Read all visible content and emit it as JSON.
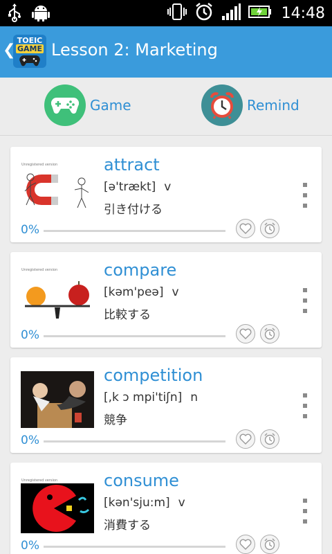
{
  "status_bar": {
    "time": "14:48",
    "icons": [
      "usb-icon",
      "android-debug-icon",
      "vibrate-icon",
      "alarm-clock-icon",
      "signal-icon",
      "battery-charging-icon"
    ]
  },
  "action_bar": {
    "back_icon": "chevron-left-icon",
    "logo_line1": "TOEIC",
    "logo_line2": "GAME",
    "title": "Lesson 2: Marketing"
  },
  "toolbar": {
    "game_label": "Game",
    "remind_label": "Remind",
    "game_color": "#3fc07a",
    "remind_color": "#3e8f96"
  },
  "cards": [
    {
      "word": "attract",
      "pronunciation": "[ə'trækt]",
      "pos": "v",
      "meaning": "引き付ける",
      "progress_text": "0%",
      "progress": 0,
      "thumb_watermark": "Unregistered version"
    },
    {
      "word": "compare",
      "pronunciation": "[kəm'peə]",
      "pos": "v",
      "meaning": "比較する",
      "progress_text": "0%",
      "progress": 0,
      "thumb_watermark": "Unregistered version"
    },
    {
      "word": "competition",
      "pronunciation": "[,k ɔ mpi'tiʃn]",
      "pos": "n",
      "meaning": "競争",
      "progress_text": "0%",
      "progress": 0,
      "thumb_watermark": ""
    },
    {
      "word": "consume",
      "pronunciation": "[kən'sju:m]",
      "pos": "v",
      "meaning": "消費する",
      "progress_text": "0%",
      "progress": 0,
      "thumb_watermark": "Unregistered version"
    }
  ],
  "colors": {
    "accent": "#2f8fd4",
    "action_bar": "#3a9bdc",
    "background": "#ededed"
  }
}
